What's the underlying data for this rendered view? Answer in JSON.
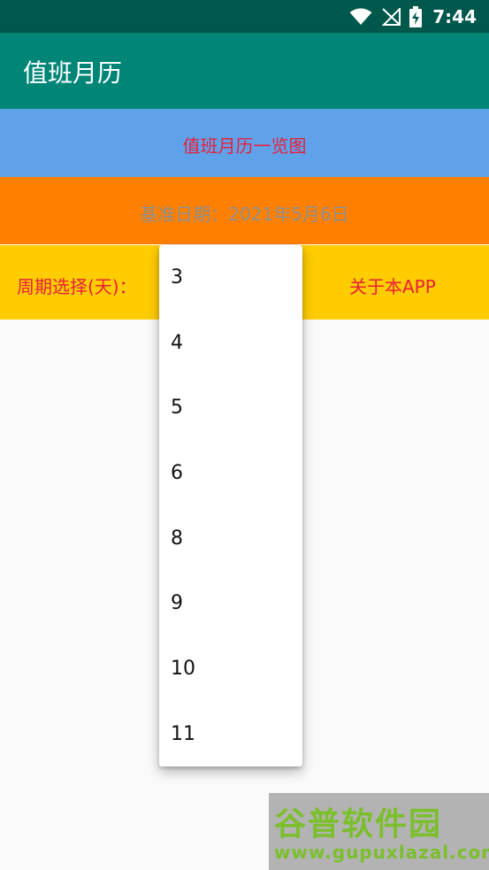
{
  "status_bar": {
    "time": "7:44",
    "icons": [
      "wifi-icon",
      "no-signal-icon",
      "battery-charging-icon"
    ]
  },
  "app_bar": {
    "title": "值班月历"
  },
  "calendar_overview_button": {
    "label": "值班月历一览图"
  },
  "base_date": {
    "text": "基准日期：2021年5月6日"
  },
  "cycle_select": {
    "label": "周期选择(天)：",
    "options": [
      "3",
      "4",
      "5",
      "6",
      "8",
      "9",
      "10",
      "11"
    ]
  },
  "about_button": {
    "label": "关于本APP"
  },
  "watermark": {
    "title": "谷普软件园",
    "url": "www.gupuxlazal.com"
  },
  "colors": {
    "status_bar": "#00574b",
    "app_bar": "#008577",
    "band_blue": "#5fa2ea",
    "band_orange": "#ff8000",
    "band_yellow": "#ffcc00",
    "accent_text": "#e8203a"
  }
}
